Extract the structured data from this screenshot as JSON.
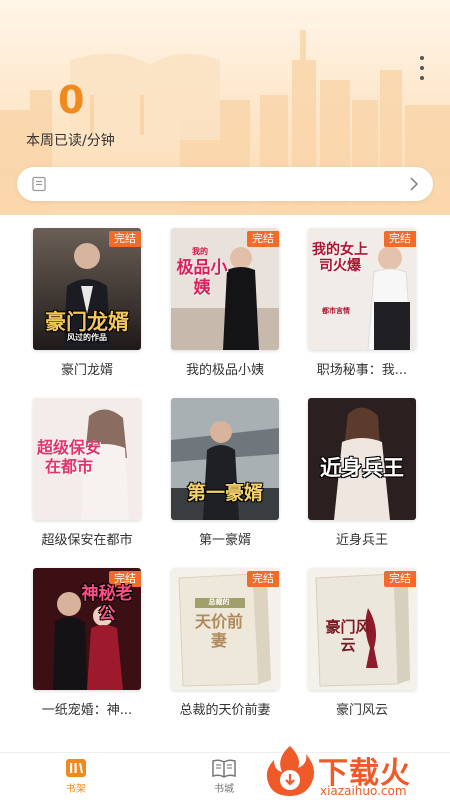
{
  "header": {
    "read_minutes": "0",
    "read_label": "本周已读/分钟"
  },
  "search": {
    "placeholder": ""
  },
  "books": [
    {
      "title": "豪门龙婿",
      "badge": "完结",
      "cover_text": "豪门龙婿",
      "cover_sub": "风过的作品"
    },
    {
      "title": "我的极品小姨",
      "badge": "完结",
      "cover_text": "极品小姨",
      "cover_sub": "我的"
    },
    {
      "title": "职场秘事：我...",
      "badge": "完结",
      "cover_text": "我的女上司火爆",
      "cover_sub": "都市言情"
    },
    {
      "title": "超级保安在都市",
      "badge": "",
      "cover_text": "超级保安在都市",
      "cover_sub": ""
    },
    {
      "title": "第一豪婿",
      "badge": "",
      "cover_text": "第一豪婿",
      "cover_sub": ""
    },
    {
      "title": "近身兵王",
      "badge": "",
      "cover_text": "近身兵王",
      "cover_sub": ""
    },
    {
      "title": "一纸宠婚：神...",
      "badge": "完结",
      "cover_text": "神秘老公",
      "cover_sub": ""
    },
    {
      "title": "总裁的天价前妻",
      "badge": "完结",
      "cover_text": "天价前妻",
      "cover_sub": "总裁的"
    },
    {
      "title": "豪门风云",
      "badge": "完结",
      "cover_text": "豪门风云",
      "cover_sub": ""
    }
  ],
  "tabs": [
    {
      "label": "书架",
      "active": true
    },
    {
      "label": "书城",
      "active": false
    }
  ],
  "watermark": {
    "brand": "下载火",
    "url": "xiazaihuo.com"
  },
  "colors": {
    "accent": "#f08a1c",
    "badge": "#f36b2a",
    "watermark": "#f05a28"
  }
}
